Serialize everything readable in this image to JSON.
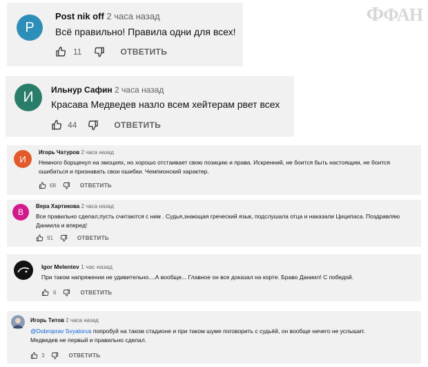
{
  "watermark": "ФАН",
  "comments": [
    {
      "avatar_letter": "Р",
      "avatar_color": "#2d8fb8",
      "author": "Post nik off",
      "time": "2 часа назад",
      "lines": [
        "Всё правильно! Правила одни для всех!"
      ],
      "likes": "11",
      "reply_label": "ОТВЕТИТЬ"
    },
    {
      "avatar_letter": "И",
      "avatar_color": "#2b7d6b",
      "author": "Ильнур Сафин",
      "time": "2 часа назад",
      "lines": [
        "Красава Медведев назло всем хейтерам рвет всех"
      ],
      "likes": "44",
      "reply_label": "ОТВЕТИТЬ"
    },
    {
      "avatar_letter": "И",
      "avatar_color": "#e35a2a",
      "author": "Игорь Чатуров",
      "time": "2 часа назад",
      "lines": [
        "Немного борщенул на эмоциях, но хорошо отстаивает свою позицию и права. Искренний, не боится быть настоящим, не боится",
        "ошибаться и признавать свои ошибки. Чемпионский характер."
      ],
      "likes": "68",
      "reply_label": "ОТВЕТИТЬ"
    },
    {
      "avatar_letter": "В",
      "avatar_color": "#d11b8c",
      "author": "Вера Хартикова",
      "time": "2 часа назад",
      "lines": [
        "Все правильно сделал,пусть считаются с ним  . Судья,знающая греческий язык, подслушала отца и наказали Циципаса. Поздравляю",
        "Даниила и вперед!"
      ],
      "likes": "91",
      "reply_label": "ОТВЕТИТЬ"
    },
    {
      "avatar_letter": "",
      "avatar_color": "#111111",
      "author": "Igor Melentev",
      "time": "1 час назад",
      "lines": [
        "При таком напряжении не удивительно....А вообще... Главное он все доказал на корте. Браво Даниил! С победой."
      ],
      "likes": "6",
      "reply_label": "ОТВЕТИТЬ"
    },
    {
      "avatar_letter": "",
      "avatar_color": "#8a9bb8",
      "author": "Игорь Титов",
      "time": "2 часа назад",
      "mention": "@Dobroprav Svyatorus",
      "lines": [
        " попробуй на таком стадионе и при таком шуме поговорить с судьёй, он вообще ничего не услышит.",
        "Медведев не первый и правильно сделал."
      ],
      "likes": "3",
      "reply_label": "ОТВЕТИТЬ"
    }
  ]
}
